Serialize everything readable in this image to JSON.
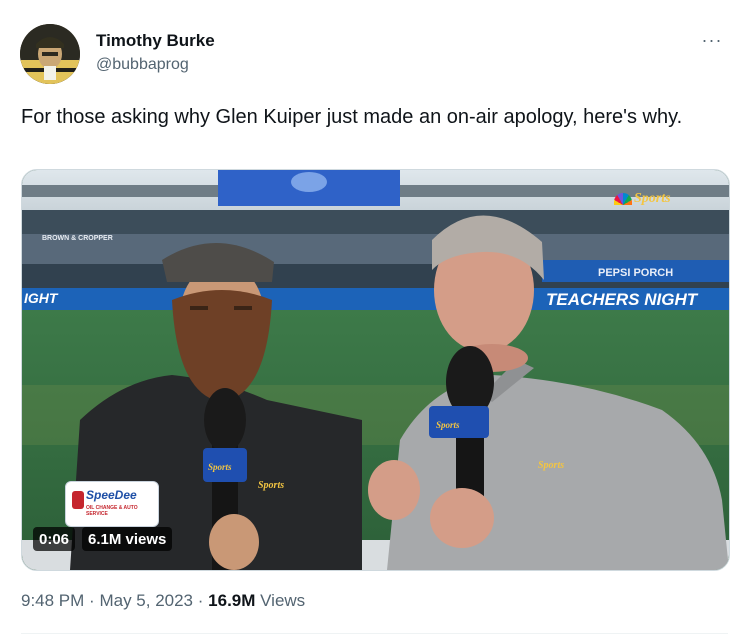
{
  "tweet": {
    "author_name": "Timothy Burke",
    "author_handle": "@bubbaprog",
    "more_label": "···",
    "text": "For those asking why Glen Kuiper just made an on-air apology, here's why.",
    "time": "9:48 PM",
    "date": "May 5, 2023",
    "views_count": "16.9M",
    "views_label": "Views",
    "separator": "·"
  },
  "video": {
    "elapsed": "0:06",
    "views_overlay": "6.1M views",
    "ribbon_left": "IGHT",
    "ribbon_right": "TEACHERS NIGHT",
    "pepsi": "PEPSI PORCH",
    "sponsor": "SpeeDee",
    "sponsor_sub": "OIL CHANGE & AUTO SERVICE",
    "brand": "Sports",
    "stand_sign": "BROWN & CROPPER"
  },
  "icons": {
    "avatar": "avatar-photo",
    "more": "more-horizontal-icon",
    "nbc": "nbc-peacock-icon"
  }
}
